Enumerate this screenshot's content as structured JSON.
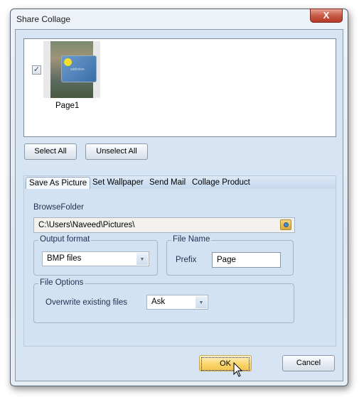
{
  "window": {
    "title": "Share Collage",
    "close_label": "X"
  },
  "pages": [
    {
      "label": "Page1",
      "checked": true,
      "thumb_text": "addictive"
    }
  ],
  "buttons": {
    "select_all": "Select All",
    "unselect_all": "Unselect All",
    "ok": "OK",
    "cancel": "Cancel"
  },
  "tabs": [
    {
      "label": "Save As Picture",
      "active": true
    },
    {
      "label": "Set Wallpaper"
    },
    {
      "label": "Send Mail"
    },
    {
      "label": "Collage Product"
    }
  ],
  "save": {
    "browse_label": "BrowseFolder",
    "path": "C:\\Users\\Naveed\\Pictures\\",
    "output_format": {
      "legend": "Output format",
      "value": "BMP files"
    },
    "file_name": {
      "legend": "File Name",
      "prefix_label": "Prefix",
      "prefix_value": "Page"
    },
    "file_options": {
      "legend": "File Options",
      "overwrite_label": "Overwrite existing files",
      "overwrite_value": "Ask"
    }
  },
  "icons": {
    "browse": "folder-browse-icon",
    "dropdown": "chevron-down-icon",
    "cursor": "mouse-pointer-icon"
  }
}
